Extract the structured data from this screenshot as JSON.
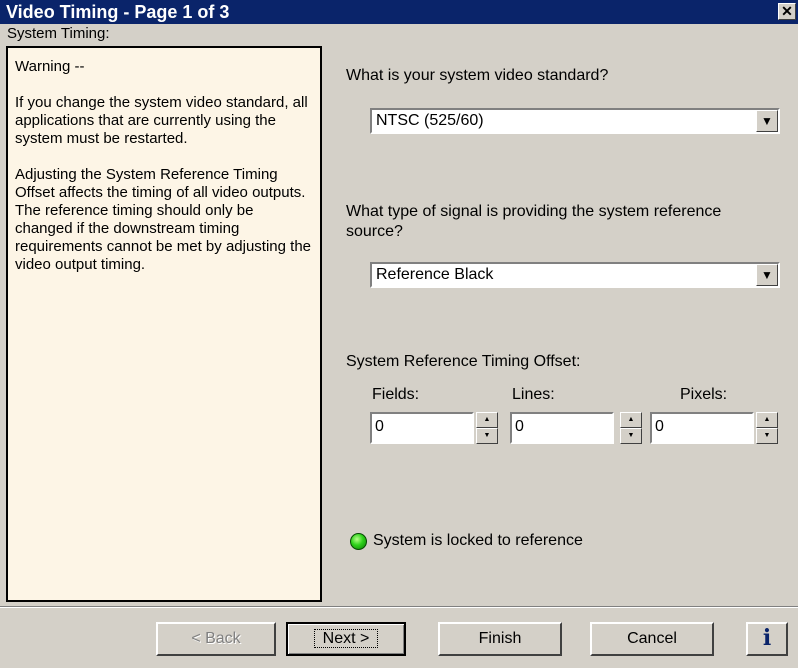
{
  "window": {
    "title": "Video Timing - Page 1 of 3",
    "close_glyph": "✕"
  },
  "section_label": "System Timing:",
  "warning": {
    "heading": "Warning --",
    "paragraph1": "If you change the system video standard, all applications that are currently using the system must be restarted.",
    "paragraph2": "Adjusting the System Reference Timing Offset affects the timing of all video outputs.  The reference timing should only be changed if the downstream timing requirements cannot be met by adjusting the video output timing."
  },
  "video_standard": {
    "question": "What is your system video standard?",
    "selected": "NTSC (525/60)"
  },
  "reference_signal": {
    "question": "What type of signal is providing the system reference source?",
    "selected": "Reference Black"
  },
  "offset": {
    "label": "System Reference Timing Offset:",
    "fields_label": "Fields:",
    "fields_value": "0",
    "lines_label": "Lines:",
    "lines_value": "0",
    "pixels_label": "Pixels:",
    "pixels_value": "0"
  },
  "status": {
    "text": "System is locked to reference",
    "led_color": "#2dd11a"
  },
  "buttons": {
    "back": "< Back",
    "next": "Next >",
    "finish": "Finish",
    "cancel": "Cancel",
    "info": "i"
  }
}
